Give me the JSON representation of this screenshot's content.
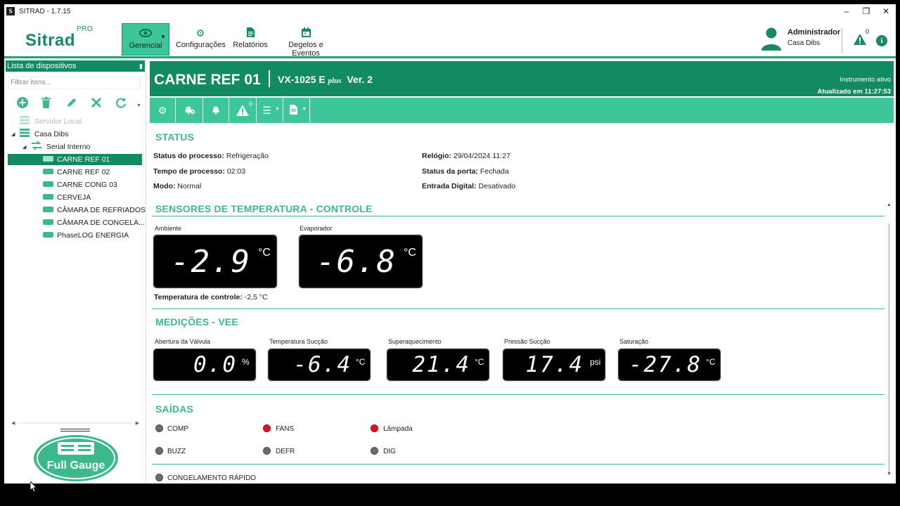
{
  "window": {
    "title": "SITRAD - 1.7.15",
    "minimize": "–",
    "restore": "❐",
    "close": "✕"
  },
  "toolbar": {
    "logo": "Sitrad",
    "logo_sup": "PRO",
    "items": [
      {
        "label": "Gerencial",
        "icon": "eye-icon"
      },
      {
        "label": "Configurações",
        "icon": "gear-icon"
      },
      {
        "label": "Relatórios",
        "icon": "document-icon"
      },
      {
        "label": "Degelos e Eventos",
        "icon": "calendar-icon"
      }
    ],
    "user_name": "Administrador",
    "user_org": "Casa Dibs",
    "alert_count": "0"
  },
  "sidebar": {
    "header": "Lista de dispositivos",
    "filter_placeholder": "Filtrar itens...",
    "tree": {
      "server": "Servidor Local",
      "site": "Casa Dibs",
      "port": "Serial Interno",
      "devices": [
        "CARNE REF 01",
        "CARNE REF 02",
        "CARNE CONG 03",
        "CERVEJA",
        "CÂMARA DE REFRIADOS",
        "CÂMARA DE CONGELA...",
        "PhaseLOG ENERGIA"
      ]
    },
    "brand": "Full Gauge"
  },
  "device": {
    "name": "CARNE REF 01",
    "model": "VX-1025 E",
    "model_suffix": "plus",
    "version": "Ver. 2",
    "status": "Instrumento ativo",
    "updated": "Atualizado em 11:27:53",
    "toolbar_alert_count": "0"
  },
  "status": {
    "title": "STATUS",
    "rows": [
      {
        "key": "Status do processo:",
        "value": "Refrigeração"
      },
      {
        "key": "Tempo de processo:",
        "value": "02:03"
      },
      {
        "key": "Modo:",
        "value": "Normal"
      },
      {
        "key": "Relógio:",
        "value": "29/04/2024  11:27"
      },
      {
        "key": "Status da porta:",
        "value": "Fechada"
      },
      {
        "key": "Entrada Digital:",
        "value": "Desativado"
      }
    ]
  },
  "sensors": {
    "title": "SENSORES DE TEMPERATURA - CONTROLE",
    "displays": [
      {
        "label": "Ambiente",
        "value": "-2.9",
        "unit": "°C"
      },
      {
        "label": "Evaporador",
        "value": "-6.8",
        "unit": "°C"
      }
    ],
    "control_key": "Temperatura  de controle:",
    "control_value": "-2,5  °C"
  },
  "measures": {
    "title": "MEDIÇÕES - VEE",
    "displays": [
      {
        "label": "Abertura da Válvula",
        "value": "0.0",
        "unit": "%"
      },
      {
        "label": "Temperatura Sucção",
        "value": "-6.4",
        "unit": "°C"
      },
      {
        "label": "Superaquecimento",
        "value": "21.4",
        "unit": "°C"
      },
      {
        "label": "Pressão Sucção",
        "value": "17.4",
        "unit": "psi"
      },
      {
        "label": "Saturação",
        "value": "-27.8",
        "unit": "°C"
      }
    ]
  },
  "outputs": {
    "title": "SAÍDAS",
    "items": [
      {
        "label": "COMP",
        "on": false
      },
      {
        "label": "FANS",
        "on": true
      },
      {
        "label": "Lâmpada",
        "on": true
      },
      {
        "label": "BUZZ",
        "on": false
      },
      {
        "label": "DEFR",
        "on": false
      },
      {
        "label": "DIG",
        "on": false
      },
      {
        "label": "CONGELAMENTO RÁPIDO",
        "on": false
      }
    ]
  },
  "colors": {
    "brand": "#128a62",
    "accent": "#3cc69a",
    "led_on": "#e0141b",
    "led_off": "#6c6c6c"
  }
}
